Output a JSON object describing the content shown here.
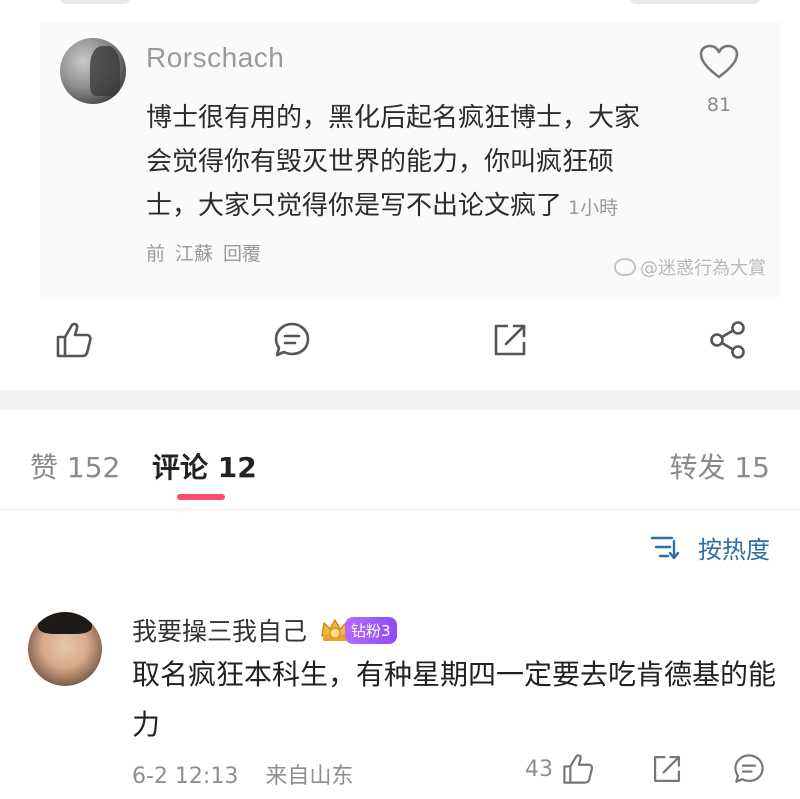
{
  "embed": {
    "username": "Rorschach",
    "text": "博士很有用的，黑化后起名疯狂博士，大家会觉得你有毁灭世界的能力，你叫疯狂硕士，大家只觉得你是写不出论文疯了",
    "time": "1小時前",
    "location": "江蘇",
    "reply_label": "回覆",
    "like_count": "81",
    "watermark": "@迷惑行為大賞"
  },
  "actions": {
    "like_icon": "thumbs-up-icon",
    "comment_icon": "comment-icon",
    "share_icon": "share-external-icon",
    "forward_icon": "share-nodes-icon"
  },
  "tabs": [
    {
      "label": "赞 152"
    },
    {
      "label": "评论 12"
    },
    {
      "label": "转发 15"
    }
  ],
  "sort": {
    "label": "按热度"
  },
  "comment": {
    "username": "我要操三我自己",
    "badge": "钻粉3",
    "text": "取名疯狂本科生，有种星期四一定要去吃肯德基的能力",
    "time": "6-2 12:13",
    "source": "来自山东",
    "like_count": "43"
  },
  "colors": {
    "accent": "#ff4b6b",
    "link": "#2f6ea5",
    "badge": "#9b55f7"
  }
}
